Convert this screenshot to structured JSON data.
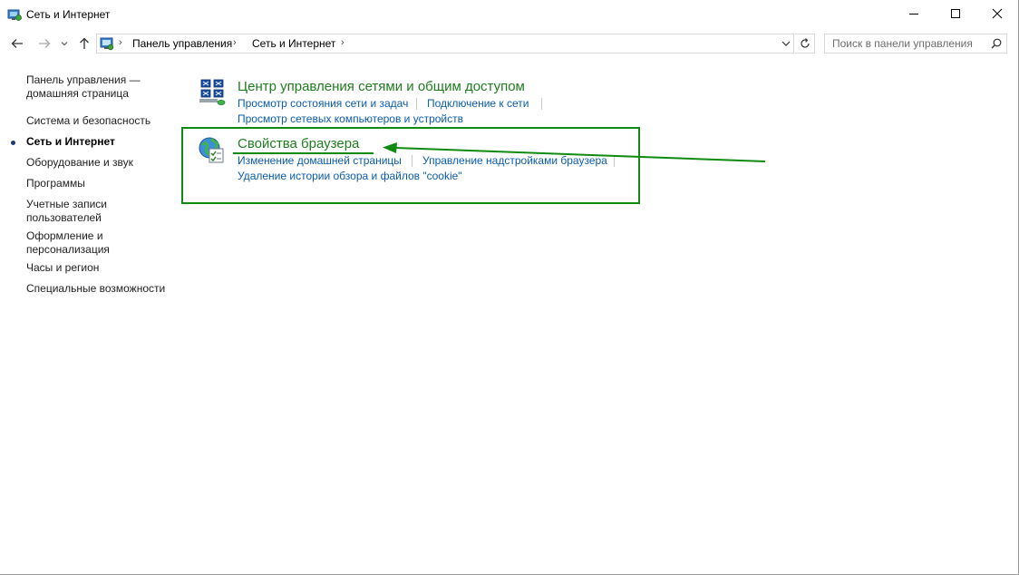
{
  "window": {
    "title": "Сеть и Интернет"
  },
  "address": {
    "crumbs": [
      "Панель управления",
      "Сеть и Интернет"
    ],
    "separator": "›"
  },
  "search": {
    "placeholder": "Поиск в панели управления"
  },
  "sidebar": {
    "items": [
      {
        "label_line1": "Панель управления —",
        "label_line2": "домашняя страница"
      },
      {
        "label": "Система и безопасность"
      },
      {
        "label": "Сеть и Интернет",
        "current": true
      },
      {
        "label": "Оборудование и звук"
      },
      {
        "label": "Программы"
      },
      {
        "label_line1": "Учетные записи",
        "label_line2": "пользователей"
      },
      {
        "label_line1": "Оформление и",
        "label_line2": "персонализация"
      },
      {
        "label": "Часы и регион"
      },
      {
        "label": "Специальные возможности"
      }
    ]
  },
  "categories": [
    {
      "title": "Центр управления сетями и общим доступом",
      "icon": "network-center-icon",
      "tasks": [
        "Просмотр состояния сети и задач",
        "Подключение к сети",
        "Просмотр сетевых компьютеров и устройств"
      ]
    },
    {
      "title": "Свойства браузера",
      "icon": "internet-options-icon",
      "tasks": [
        "Изменение домашней страницы",
        "Управление надстройками браузера",
        "Удаление истории обзора и файлов \"cookie\""
      ]
    }
  ],
  "colors": {
    "category_title": "#1e7d1e",
    "task_link": "#0b5cad",
    "annotation": "#118a11"
  }
}
